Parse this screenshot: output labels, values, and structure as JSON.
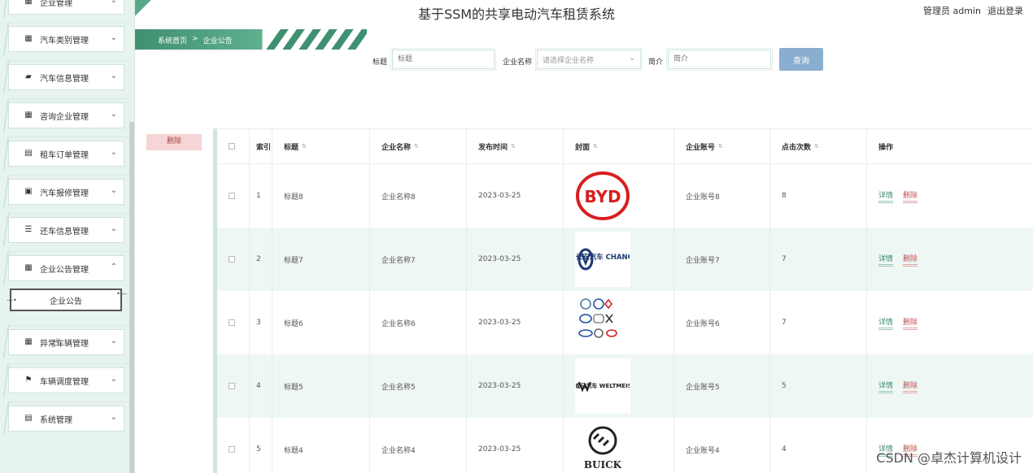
{
  "app": {
    "title": "基于SSM的共享电动汽车租赁系统",
    "user_label": "管理员 admin",
    "logout_label": "退出登录"
  },
  "sidebar": {
    "items": [
      {
        "label": "企业管理",
        "icon": "grid-icon"
      },
      {
        "label": "汽车类别管理",
        "icon": "grid-icon"
      },
      {
        "label": "汽车信息管理",
        "icon": "car-icon"
      },
      {
        "label": "咨询企业管理",
        "icon": "grid-icon"
      },
      {
        "label": "租车订单管理",
        "icon": "clipboard-icon"
      },
      {
        "label": "汽车报修管理",
        "icon": "clipboard-check-icon"
      },
      {
        "label": "还车信息管理",
        "icon": "list-icon"
      },
      {
        "label": "企业公告管理",
        "icon": "grid-icon",
        "expanded": true
      },
      {
        "label": "异常车辆管理",
        "icon": "grid-icon"
      },
      {
        "label": "车辆调度管理",
        "icon": "flag-icon"
      },
      {
        "label": "系统管理",
        "icon": "document-icon"
      }
    ],
    "submenu_active": "企业公告"
  },
  "breadcrumb": {
    "home": "系统首页",
    "separator": ">",
    "current": "企业公告"
  },
  "search": {
    "title_label": "标题",
    "title_placeholder": "标题",
    "corp_label": "企业名称",
    "corp_placeholder": "请选择企业名称",
    "intro_label": "简介",
    "intro_placeholder": "简介",
    "button_label": "查询"
  },
  "actions": {
    "delete_label": "删除"
  },
  "table": {
    "headers": {
      "index": "索引",
      "title": "标题",
      "corp": "企业名称",
      "date": "发布时间",
      "cover": "封面",
      "account": "企业账号",
      "clicks": "点击次数",
      "ops": "操作"
    },
    "rows": [
      {
        "index": "1",
        "title": "标题8",
        "corp": "企业名称8",
        "date": "2023-03-25",
        "cover": "BYD",
        "account": "企业账号8",
        "clicks": "8"
      },
      {
        "index": "2",
        "title": "标题7",
        "corp": "企业名称7",
        "date": "2023-03-25",
        "cover": "长安汽车 CHANGAN",
        "account": "企业账号7",
        "clicks": "7"
      },
      {
        "index": "3",
        "title": "标题6",
        "corp": "企业名称6",
        "date": "2023-03-25",
        "cover": "",
        "account": "企业账号6",
        "clicks": "7"
      },
      {
        "index": "4",
        "title": "标题5",
        "corp": "企业名称5",
        "date": "2023-03-25",
        "cover": "威马汽车 WELTMEISTER",
        "account": "企业账号5",
        "clicks": "5"
      },
      {
        "index": "5",
        "title": "标题4",
        "corp": "企业名称4",
        "date": "2023-03-25",
        "cover": "BUICK",
        "account": "企业账号4",
        "clicks": "4"
      }
    ],
    "detail_label": "详情",
    "delete_label": "删除"
  },
  "watermark": "CSDN @卓杰计算机设计",
  "colors": {
    "primary_green": "#3f9070",
    "search_button": "#8aaecf",
    "delete_bg": "#f5d5d5",
    "row_alt": "#eef7f3"
  }
}
